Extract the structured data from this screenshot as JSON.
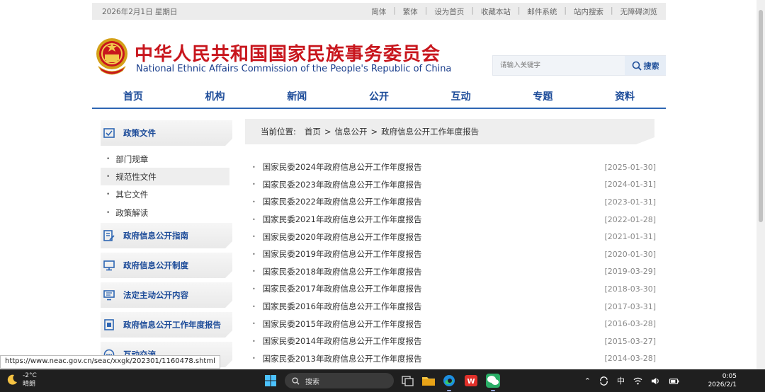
{
  "topbar": {
    "date": "2026年2月1日 星期日",
    "links": [
      "简体",
      "繁体",
      "设为首页",
      "收藏本站",
      "邮件系统",
      "站内搜索",
      "无障碍浏览"
    ]
  },
  "header": {
    "title_zh": "中华人民共和国国家民族事务委员会",
    "title_en": "National Ethnic Affairs Commission of the People's Republic of China"
  },
  "search": {
    "placeholder": "请输入关键字",
    "button": "搜索"
  },
  "nav": [
    "首页",
    "机构",
    "新闻",
    "公开",
    "互动",
    "专题",
    "资料"
  ],
  "sidebar": {
    "policy": "政策文件",
    "subitems": [
      "部门规章",
      "规范性文件",
      "其它文件",
      "政策解读"
    ],
    "guide": "政府信息公开指南",
    "system": "政府信息公开制度",
    "statutory": "法定主动公开内容",
    "annual": "政府信息公开工作年度报告",
    "interact": "互动交流"
  },
  "breadcrumb": {
    "prefix": "当前位置:",
    "home": "首页",
    "sep": ">",
    "info": "信息公开",
    "current": "政府信息公开工作年度报告"
  },
  "reports": [
    {
      "title": "国家民委2024年政府信息公开工作年度报告",
      "date": "[2025-01-30]"
    },
    {
      "title": "国家民委2023年政府信息公开工作年度报告",
      "date": "[2024-01-31]"
    },
    {
      "title": "国家民委2022年政府信息公开工作年度报告",
      "date": "[2023-01-31]"
    },
    {
      "title": "国家民委2021年政府信息公开工作年度报告",
      "date": "[2022-01-28]"
    },
    {
      "title": "国家民委2020年政府信息公开工作年度报告",
      "date": "[2021-01-31]"
    },
    {
      "title": "国家民委2019年政府信息公开工作年度报告",
      "date": "[2020-01-30]"
    },
    {
      "title": "国家民委2018年政府信息公开工作年度报告",
      "date": "[2019-03-29]"
    },
    {
      "title": "国家民委2017年政府信息公开工作年度报告",
      "date": "[2018-03-30]"
    },
    {
      "title": "国家民委2016年政府信息公开工作年度报告",
      "date": "[2017-03-31]"
    },
    {
      "title": "国家民委2015年政府信息公开工作年度报告",
      "date": "[2016-03-28]"
    },
    {
      "title": "国家民委2014年政府信息公开工作年度报告",
      "date": "[2015-03-27]"
    },
    {
      "title": "国家民委2013年政府信息公开工作年度报告",
      "date": "[2014-03-28]"
    }
  ],
  "status_url": "https://www.neac.gov.cn/seac/xxgk/202301/1160478.shtml",
  "taskbar": {
    "temp": "-2°C",
    "weather": "晴朗",
    "search": "搜索",
    "ime": "中",
    "time": "0:05",
    "date": "2026/2/1"
  },
  "colors": {
    "brand_red": "#c8161d",
    "brand_blue": "#1c4b99",
    "nav_line": "#2e66b3"
  }
}
